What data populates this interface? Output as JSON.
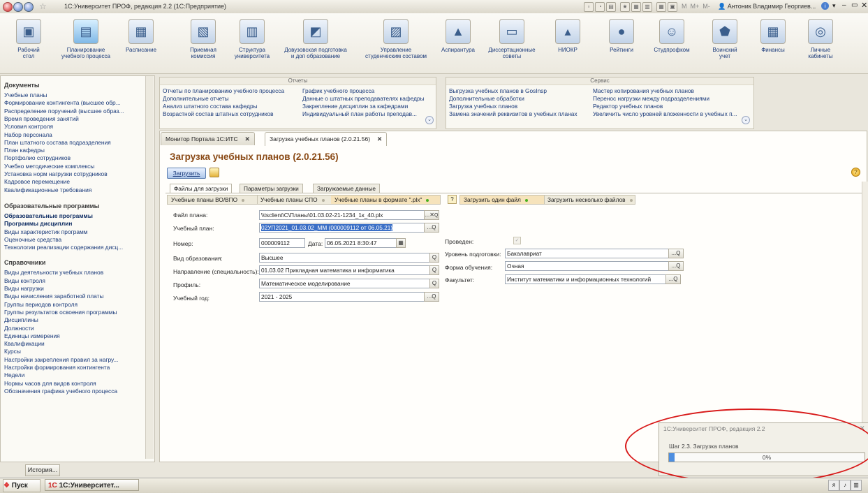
{
  "window": {
    "title": "1С:Университет ПРОФ, редакция 2.2  (1С:Предприятие)",
    "user": "Антоник Владимир Георгиев...",
    "mem_buttons": [
      "M",
      "M+",
      "M-"
    ]
  },
  "toolbar": [
    {
      "label1": "Рабочий",
      "label2": "стол",
      "icon": "desk-icon"
    },
    {
      "label1": "Планирование",
      "label2": "учебного процесса",
      "icon": "planning-icon"
    },
    {
      "label1": "Расписание",
      "label2": "",
      "icon": "schedule-icon"
    },
    {
      "label1": "Приемная",
      "label2": "комиссия",
      "icon": "admission-icon"
    },
    {
      "label1": "Структура",
      "label2": "университета",
      "icon": "structure-icon"
    },
    {
      "label1": "Довузовская подготовка",
      "label2": "и доп образование",
      "icon": "prep-icon"
    },
    {
      "label1": "Управление",
      "label2": "студенческим составом",
      "icon": "students-icon"
    },
    {
      "label1": "Аспирантура",
      "label2": "",
      "icon": "graduate-cap-icon"
    },
    {
      "label1": "Диссертационные",
      "label2": "советы",
      "icon": "dissertation-icon"
    },
    {
      "label1": "НИОКР",
      "label2": "",
      "icon": "research-icon"
    },
    {
      "label1": "Рейтинги",
      "label2": "",
      "icon": "ratings-icon"
    },
    {
      "label1": "Студпрофком",
      "label2": "",
      "icon": "union-icon"
    },
    {
      "label1": "Воинский",
      "label2": "учет",
      "icon": "military-icon"
    },
    {
      "label1": "Финансы",
      "label2": "",
      "icon": "finance-icon"
    },
    {
      "label1": "Личные",
      "label2": "кабинеты",
      "icon": "www-icon"
    }
  ],
  "left_panel": {
    "documents_header": "Документы",
    "documents": [
      "Учебные планы",
      "Формирование контингента (высшее обр...",
      "Распределение поручений (высшее образ...",
      "Время проведения занятий",
      "Условия контроля",
      "Набор персонала",
      "План штатного состава подразделения",
      "План кафедры",
      "Портфолио сотрудников",
      "Учебно методические комплексы",
      "Установка норм нагрузки сотрудников",
      "Кадровое перемещение",
      "Квалификационные требования"
    ],
    "programs_header": "Образовательные программы",
    "programs": [
      "Образовательные программы",
      "Программы дисциплин",
      "Виды характеристик программ",
      "Оценочные средства",
      "Технологии реализации содержания дисц..."
    ],
    "refs_header": "Справочники",
    "refs": [
      "Виды деятельности учебных планов",
      "Виды контроля",
      "Виды нагрузки",
      "Виды начисления заработной платы",
      "Группы периодов контроля",
      "Группы результатов освоения программы",
      "Дисциплины",
      "Должности",
      "Единицы измерения",
      "Квалификации",
      "Курсы",
      "Настройки закрепления правил за нагру...",
      "Настройки формирования контингента",
      "Недели",
      "Нормы часов для видов контроля",
      "Обозначения графика учебного процесса"
    ],
    "history_button": "История..."
  },
  "reports_panel": {
    "header": "Отчеты",
    "col1": [
      "Отчеты по планированию учебного процесса",
      "Дополнительные отчеты",
      "Анализ штатного состава кафедры",
      "Возрастной состав штатных сотрудников"
    ],
    "col2": [
      "График учебного процесса",
      "Данные о штатных преподавателях кафедры",
      "Закрепление дисциплин за кафедрами",
      "Индивидуальный план работы преподав..."
    ]
  },
  "service_panel": {
    "header": "Сервис",
    "col1": [
      "Выгрузка учебных планов в GosInsp",
      "Дополнительные обработки",
      "Загрузка учебных планов",
      "Замена значений реквизитов в учебных планах"
    ],
    "col2": [
      "Мастер копирования учебных планов",
      "Перенос нагрузки между подразделениями",
      "Редактор учебных планов",
      "Увеличить число уровней вложенности в учебных п..."
    ]
  },
  "tabs": [
    {
      "label": "Монитор Портала 1С:ИТС",
      "close": "✕"
    },
    {
      "label": "Загрузка учебных планов (2.0.21.56)",
      "close": "✕"
    }
  ],
  "form": {
    "title": "Загрузка учебных планов (2.0.21.56)",
    "load_button": "Загрузить",
    "subtabs": [
      "Файлы для загрузки",
      "Параметры загрузки",
      "Загружаемые данные"
    ],
    "plan_types": [
      "Учебные планы ВО/ВПО",
      "Учебные планы СПО",
      "Учебные планы в формате \".plx\""
    ],
    "load_modes": [
      "Загрузить один файл",
      "Загрузить несколько файлов"
    ],
    "help": "?",
    "fields": {
      "file_label": "Файл плана:",
      "file_value": "\\\\tsclient\\C\\Планы\\01.03.02-21-1234_1к_40.plx",
      "plan_label": "Учебный план:",
      "plan_value": "02УП2021_01.03.02_ММ (000009112 от 06.05.21)",
      "number_label": "Номер:",
      "number_value": "000009112",
      "date_label": "Дата:",
      "date_value": "06.05.2021  8:30:47",
      "edu_type_label": "Вид образования:",
      "edu_type_value": "Высшее",
      "direction_label": "Направление (специальность):",
      "direction_value": "01.03.02 Прикладная математика и информатика",
      "profile_label": "Профиль:",
      "profile_value": "Математическое моделирование",
      "year_label": "Учебный год:",
      "year_value": "2021 - 2025",
      "posted_label": "Проведен:",
      "level_label": "Уровень подготовки:",
      "level_value": "Бакалавриат",
      "form_label": "Форма обучения:",
      "form_value": "Очная",
      "faculty_label": "Факультет:",
      "faculty_value": "Институт математики и информационных технологий"
    }
  },
  "progress_popup": {
    "title": "1С:Университет ПРОФ, редакция 2.2",
    "step": "Шаг 2.3. Загрузка планов",
    "percent_text": "0%",
    "progress": 0.03,
    "highlight_color": "#d81a1a"
  },
  "taskbar": {
    "start": "Пуск",
    "task": "1С:Университет..."
  }
}
